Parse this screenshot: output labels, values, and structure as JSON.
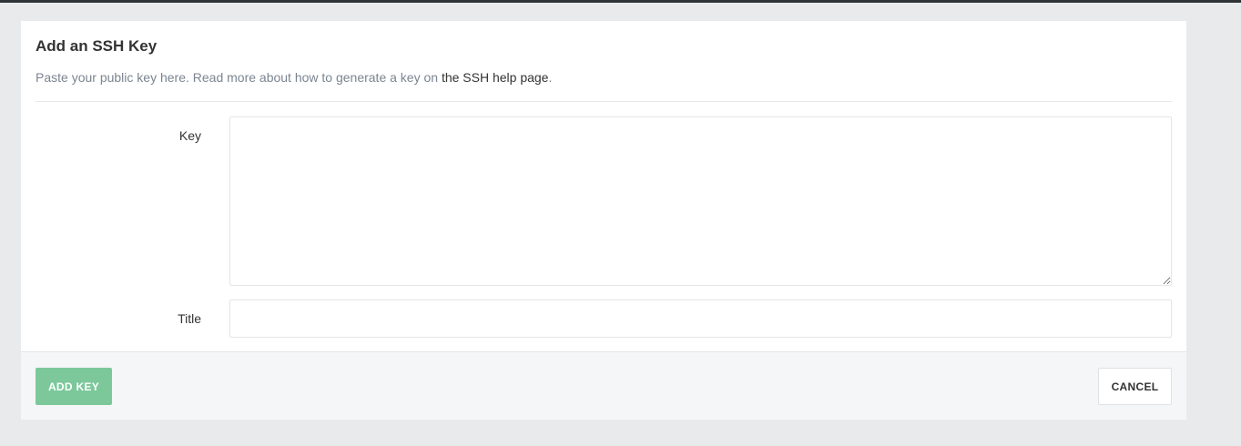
{
  "panel": {
    "title": "Add an SSH Key",
    "description": "Paste your public key here. Read more about how to generate a key on ",
    "description_link": "the SSH help page",
    "description_end": "."
  },
  "form": {
    "key_label": "Key",
    "key_value": "",
    "title_label": "Title",
    "title_value": ""
  },
  "footer": {
    "add_label": "ADD KEY",
    "add_disabled": true,
    "cancel_label": "CANCEL"
  },
  "colors": {
    "page_background": "#e9eaeb",
    "top_bar": "#2f3336",
    "add_button": "#7cc89b",
    "link_text": "#333333",
    "muted_text": "#7b8591"
  }
}
